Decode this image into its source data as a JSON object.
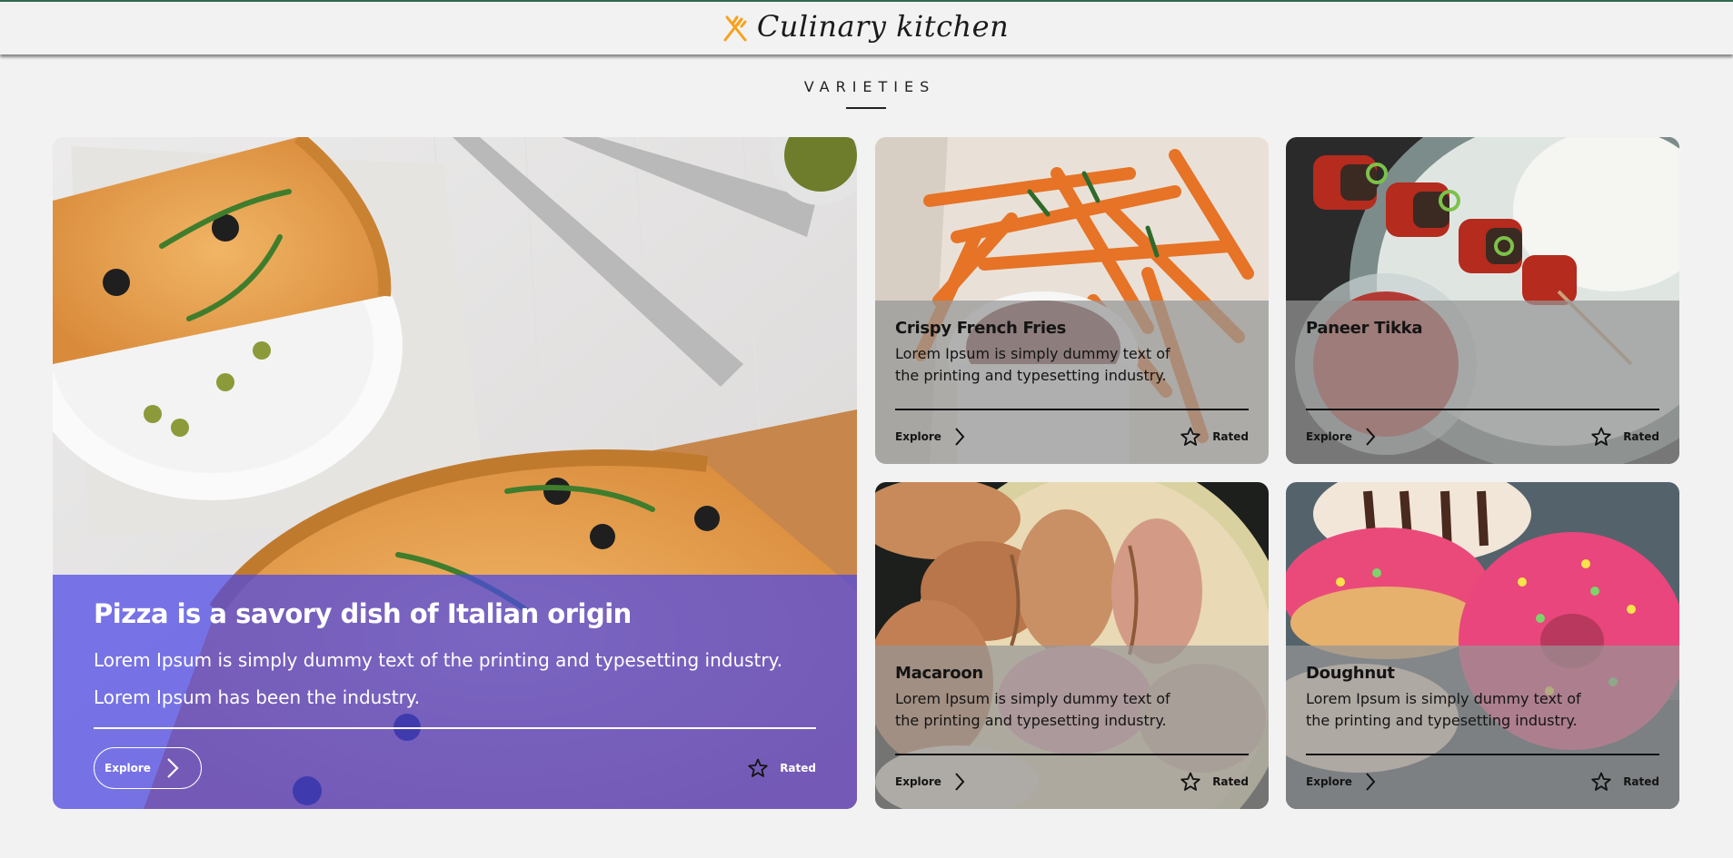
{
  "brand": {
    "name": "Culinary kitchen",
    "accent": "#f7a21b"
  },
  "section": {
    "title": "VARIETIES"
  },
  "featured": {
    "title": "Pizza is a savory dish of Italian origin",
    "description_line1": "Lorem Ipsum is simply dummy text of the printing and typesetting industry.",
    "description_line2": "Lorem Ipsum has been the industry.",
    "explore_label": "Explore",
    "rated_label": "Rated",
    "overlay_color": "#4c46e6",
    "image": "pizza"
  },
  "cards": [
    {
      "title": "Crispy French Fries",
      "description": "Lorem Ipsum is simply dummy text of the printing and typesetting industry.",
      "explore_label": "Explore",
      "rated_label": "Rated",
      "image": "fries"
    },
    {
      "title": "Paneer Tikka",
      "description": "",
      "explore_label": "Explore",
      "rated_label": "Rated",
      "image": "paneer-tikka"
    },
    {
      "title": "Macaroon",
      "description": "Lorem Ipsum is simply dummy text of the printing and typesetting industry.",
      "explore_label": "Explore",
      "rated_label": "Rated",
      "image": "macaroons"
    },
    {
      "title": "Doughnut",
      "description": "Lorem Ipsum is simply dummy text of the printing and typesetting industry.",
      "explore_label": "Explore",
      "rated_label": "Rated",
      "image": "doughnuts"
    }
  ],
  "icons": {
    "brand": "fork-knife-icon",
    "explore": "chevron-right-icon",
    "rating": "star-outline-icon"
  }
}
